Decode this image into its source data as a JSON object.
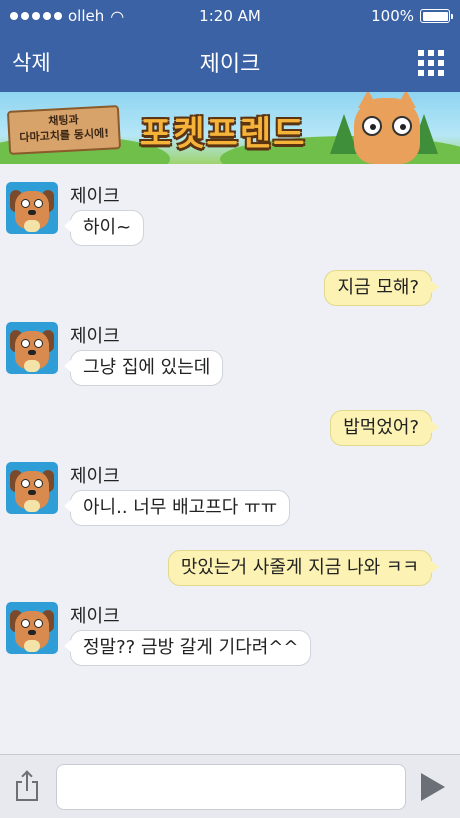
{
  "status_bar": {
    "carrier": "olleh",
    "time": "1:20 AM",
    "battery": "100%",
    "wifi_icon": "wifi-icon"
  },
  "nav": {
    "left_button": "삭제",
    "title": "제이크",
    "menu_icon": "grid-menu-icon"
  },
  "banner": {
    "tagline_line1": "채팅과",
    "tagline_line2": "다마고치를 동시에!",
    "title": "포켓프렌드"
  },
  "messages": [
    {
      "direction": "in",
      "sender": "제이크",
      "text": "하이~"
    },
    {
      "direction": "out",
      "text": "지금 모해?"
    },
    {
      "direction": "in",
      "sender": "제이크",
      "text": "그냥 집에 있는데"
    },
    {
      "direction": "out",
      "text": "밥먹었어?"
    },
    {
      "direction": "in",
      "sender": "제이크",
      "text": "아니.. 너무 배고프다 ㅠㅠ"
    },
    {
      "direction": "out",
      "text": "맛있는거 사줄게 지금 나와 ㅋㅋ"
    },
    {
      "direction": "in",
      "sender": "제이크",
      "text": "정말?? 금방 갈게 기다려^^"
    }
  ],
  "composer": {
    "input_value": "",
    "share_icon": "share-icon",
    "send_icon": "send-icon"
  },
  "colors": {
    "nav_bg": "#3c62a6",
    "chat_bg": "#eef0f5",
    "outgoing_bubble": "#fbf2b3",
    "incoming_bubble": "#ffffff"
  }
}
